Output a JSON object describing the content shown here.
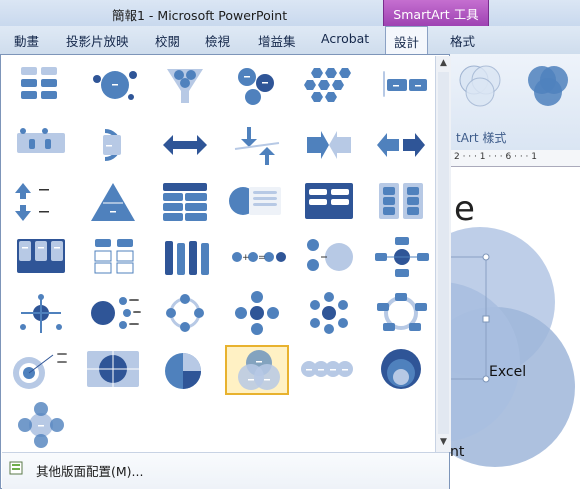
{
  "window": {
    "title": "簡報1 - Microsoft PowerPoint",
    "contextual_tab_group": "SmartArt 工具"
  },
  "tabs": [
    {
      "label": "動畫"
    },
    {
      "label": "投影片放映"
    },
    {
      "label": "校閱"
    },
    {
      "label": "檢視"
    },
    {
      "label": "增益集"
    },
    {
      "label": "Acrobat"
    },
    {
      "label": "設計"
    },
    {
      "label": "格式"
    }
  ],
  "ribbon": {
    "group_label": "tArt 樣式"
  },
  "ruler": {
    "text": "2 · · · 1 · · · 6 · · · 1"
  },
  "slide": {
    "title_fragment": "e",
    "diagram_label_1": "Excel",
    "diagram_label_2": "nt"
  },
  "gallery": {
    "layouts": [
      "list-picture-stack",
      "circle-relationship",
      "funnel",
      "gear",
      "hexagon-cluster",
      "segmented-bars",
      "bracket-list",
      "circular-arrows",
      "opposing-arrows",
      "balance",
      "converging-arrows",
      "opposing-ideas",
      "up-down-arrows",
      "pyramid",
      "stacked-list",
      "picture-accent-circle",
      "framed-list",
      "grouped-list",
      "vertical-list",
      "labeled-hierarchy",
      "column-list",
      "equation",
      "vertical-equation",
      "hierarchy-branch",
      "radial-target",
      "radial-list",
      "cycle",
      "radial-cycle",
      "diverging-radial",
      "segmented-cycle",
      "target",
      "quadrant-matrix",
      "pie-cycle",
      "basic-venn",
      "linear-venn",
      "stacked-venn",
      "radial-venn"
    ],
    "selected_index": 33,
    "more_layouts_label": "其他版面配置(M)..."
  },
  "colors": {
    "accent": "#4f81bd",
    "dark": "#2f5597",
    "light": "#b7c9e5",
    "highlight": "#e8b22e"
  }
}
